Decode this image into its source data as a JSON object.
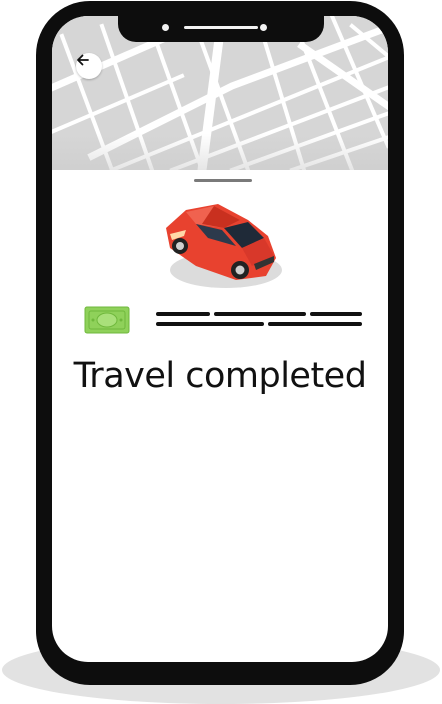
{
  "status": {
    "title": "Travel completed"
  },
  "icons": {
    "back": "arrow-left-icon",
    "car": "car-icon",
    "payment": "cash-icon"
  },
  "colors": {
    "car_body": "#e8422f",
    "cash": "#8fd15a",
    "map_background": "#d6d6d6",
    "map_roads": "#ffffff",
    "phone_frame": "#0d0d0d"
  }
}
